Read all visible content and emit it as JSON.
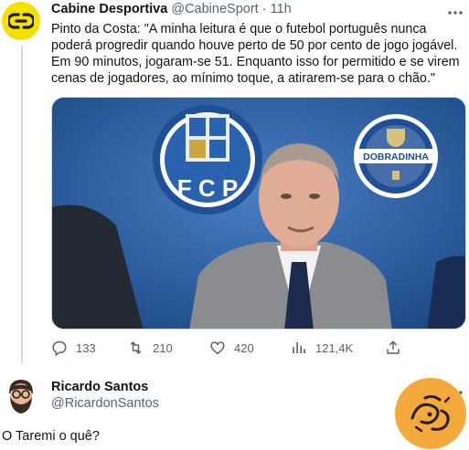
{
  "tweet1": {
    "author_name": "Cabine Desportiva",
    "handle": "@CabineSport",
    "separator": "·",
    "time": "11h",
    "text": "Pinto da Costa: \"A minha leitura é que o futebol português nunca poderá progredir quando houve perto de 50 por cento de jogo jogável. Em 90 minutos, jogaram-se  51. Enquanto isso for permitido e se virem cenas de jogadores, ao mínimo toque, a atirarem-se para o chão.\"",
    "media": {
      "crest_letters": "F C P",
      "badge_text": "DOBRADINHA"
    },
    "actions": {
      "replies": "133",
      "retweets": "210",
      "likes": "420",
      "views": "121,4K"
    }
  },
  "tweet2": {
    "author_name": "Ricardo Santos",
    "handle": "@RicardonSantos",
    "text": "O Taremi o quê?"
  },
  "icons": {
    "more": "more-icon",
    "reply": "reply-icon",
    "retweet": "retweet-icon",
    "like": "heart-icon",
    "views": "views-icon",
    "share": "share-icon"
  },
  "colors": {
    "cabine_avatar": "#f5e100",
    "muted_text": "#536471",
    "fc_porto_blue": "#2b5d9d",
    "watermark": "#f4a93c"
  }
}
